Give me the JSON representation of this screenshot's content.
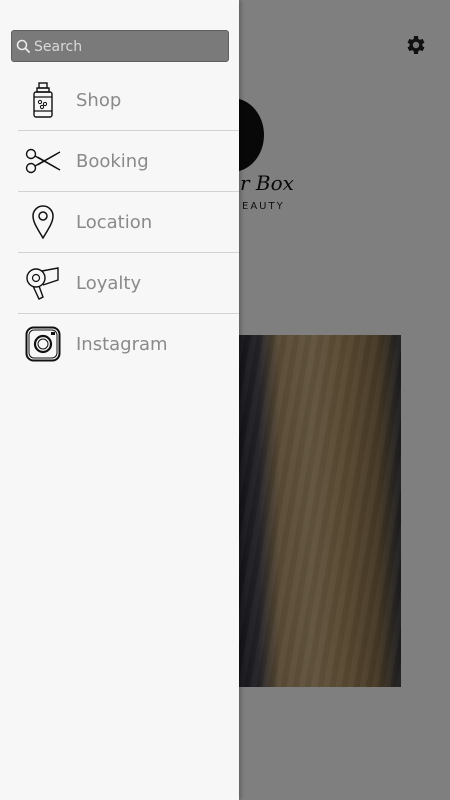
{
  "search": {
    "placeholder": "Search",
    "value": ""
  },
  "menu": {
    "items": [
      {
        "label": "Shop",
        "icon": "bottle-icon"
      },
      {
        "label": "Booking",
        "icon": "scissors-icon"
      },
      {
        "label": "Location",
        "icon": "map-pin-icon"
      },
      {
        "label": "Loyalty",
        "icon": "hairdryer-icon"
      },
      {
        "label": "Instagram",
        "icon": "instagram-icon"
      }
    ]
  },
  "background": {
    "logo_text": "r Box",
    "logo_subtext": "EAUTY"
  },
  "colors": {
    "drawer_bg": "#f7f7f7",
    "label": "#8a8a8a",
    "search_bg": "#7a7a7a"
  }
}
